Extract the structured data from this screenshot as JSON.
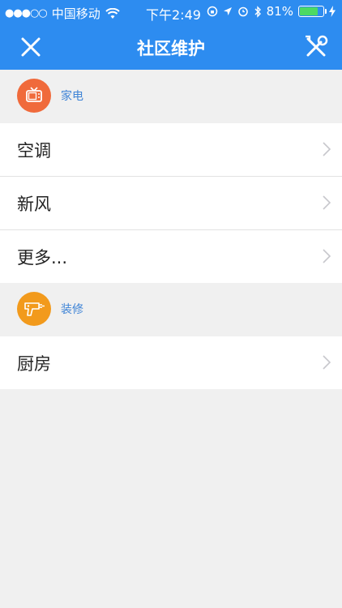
{
  "status": {
    "signal": "●●●○○",
    "carrier": "中国移动",
    "time": "下午2:49",
    "battery_pct": "81%",
    "battery_level": 0.81
  },
  "nav": {
    "title": "社区维护"
  },
  "sections": [
    {
      "title": "家电",
      "icon": "tv-icon",
      "color": "#f06a3b",
      "items": [
        {
          "label": "空调"
        },
        {
          "label": "新风"
        },
        {
          "label": "更多..."
        }
      ]
    },
    {
      "title": "装修",
      "icon": "drill-icon",
      "color": "#f29a1c",
      "items": [
        {
          "label": "厨房"
        }
      ]
    }
  ],
  "colors": {
    "nav_bg": "#2d8cf0",
    "section_label": "#3f84d6",
    "page_bg": "#f0f0f0"
  }
}
